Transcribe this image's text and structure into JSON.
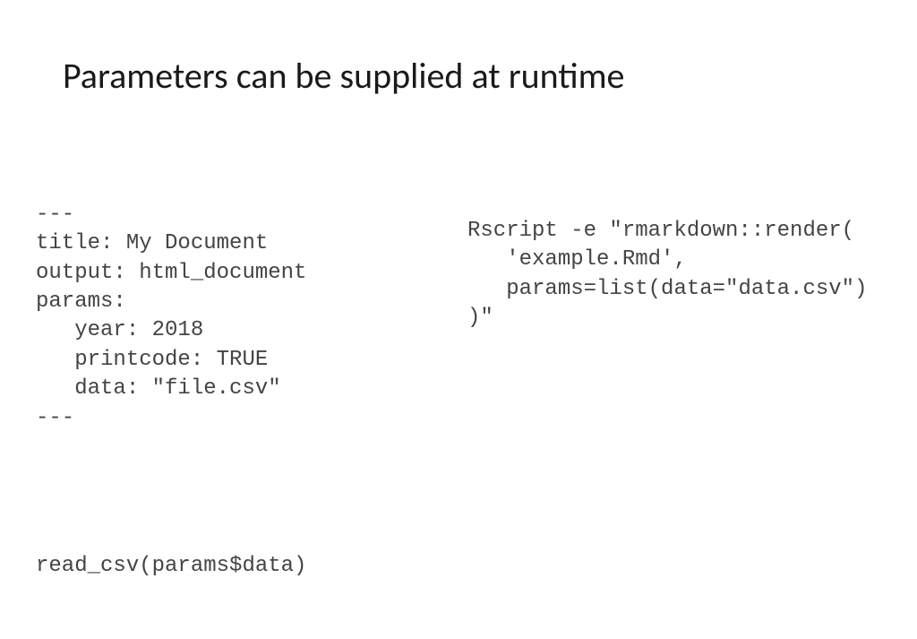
{
  "slide": {
    "title": "Parameters can be supplied at runtime"
  },
  "code": {
    "left_yaml": "---\ntitle: My Document\noutput: html_document\nparams:\n   year: 2018\n   printcode: TRUE\n   data: \"file.csv\"\n---",
    "left_bottom": "read_csv(params$data)",
    "right_cmd": "Rscript -e \"rmarkdown::render(\n   'example.Rmd',\n   params=list(data=\"data.csv\")\n)\""
  }
}
